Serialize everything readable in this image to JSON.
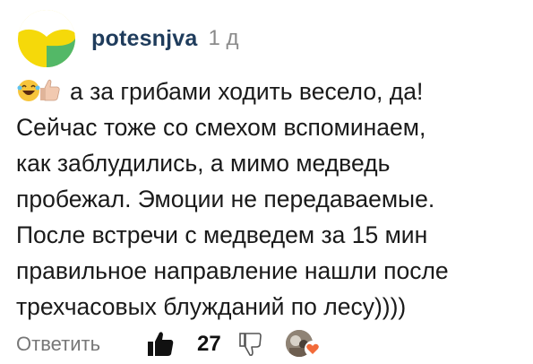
{
  "comment": {
    "author": "potesnjva",
    "time": "1 д",
    "text_line1": "а за грибами ходить весело, да!",
    "lines": [
      "Сейчас тоже со смехом вспоминаем,",
      "как заблудились, а мимо медведь",
      "пробежал. Эмоции не передаваемые.",
      "После встречи с медведем за 15 мин",
      "правильное направление нашли после",
      "трехчасовых блужданий по лесу))))"
    ],
    "emojis": [
      "laughing-face-emoji",
      "thumbs-up-light-skin-emoji"
    ]
  },
  "footer": {
    "reply_label": "Ответить",
    "like_count": "27"
  },
  "colors": {
    "author": "#1f3c5c",
    "muted": "#8a8a8a",
    "avatar_yellow": "#f5d90a",
    "avatar_green": "#53b867",
    "heart": "#f26b3a"
  }
}
